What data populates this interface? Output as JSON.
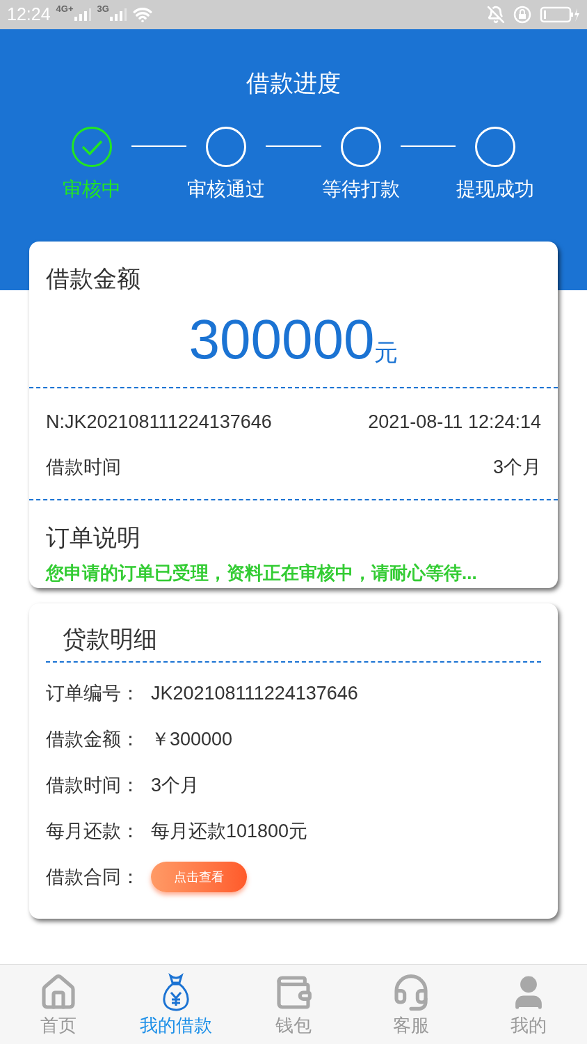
{
  "status_bar": {
    "time": "12:24",
    "network_1": "4G+",
    "network_2": "3G"
  },
  "header": {
    "title": "借款进度"
  },
  "steps": [
    {
      "label": "审核中",
      "done": true
    },
    {
      "label": "审核通过",
      "done": false
    },
    {
      "label": "等待打款",
      "done": false
    },
    {
      "label": "提现成功",
      "done": false
    }
  ],
  "loan_card": {
    "title": "借款金额",
    "amount": "300000",
    "unit": "元",
    "order_no": "N:JK202108111224137646",
    "datetime": "2021-08-11 12:24:14",
    "term_label": "借款时间",
    "term_value": "3个月",
    "note_title": "订单说明",
    "note_text": "您申请的订单已受理，资料正在审核中，请耐心等待..."
  },
  "detail_card": {
    "title": "贷款明细",
    "rows": [
      {
        "label": "订单编号：",
        "value": "JK202108111224137646",
        "kind": "text"
      },
      {
        "label": "借款金额：",
        "value": "￥300000",
        "kind": "text"
      },
      {
        "label": "借款时间：",
        "value": "3个月",
        "kind": "text"
      },
      {
        "label": "每月还款：",
        "value": "每月还款101800元",
        "kind": "text"
      },
      {
        "label": "借款合同：",
        "value": "点击查看",
        "kind": "button"
      }
    ]
  },
  "nav": [
    {
      "label": "首页",
      "selected": false
    },
    {
      "label": "我的借款",
      "selected": true
    },
    {
      "label": "钱包",
      "selected": false
    },
    {
      "label": "客服",
      "selected": false
    },
    {
      "label": "我的",
      "selected": false
    }
  ]
}
